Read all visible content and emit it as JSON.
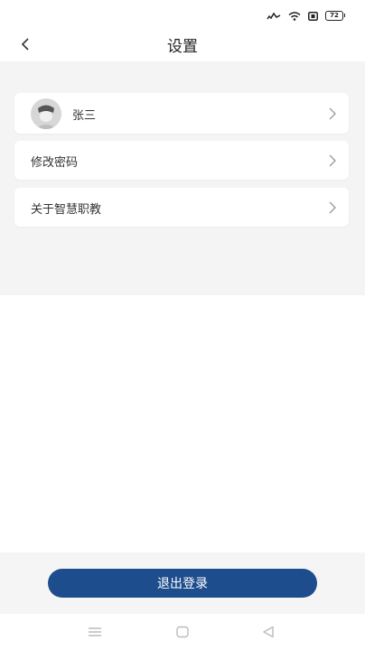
{
  "status_bar": {
    "battery_level": "72",
    "icons": [
      "signal-icon",
      "wifi-icon",
      "sim-icon",
      "battery-icon"
    ]
  },
  "nav": {
    "title": "设置",
    "back_icon": "chevron-left-icon"
  },
  "settings": {
    "profile_name": "张三",
    "items": [
      {
        "label": "修改密码"
      },
      {
        "label": "关于智慧职教"
      }
    ]
  },
  "actions": {
    "logout_label": "退出登录"
  },
  "colors": {
    "accent": "#1d4d8c",
    "page_bg": "#f4f4f4"
  },
  "system_nav": {
    "icons": [
      "menu-icon",
      "home-icon",
      "back-triangle-icon"
    ]
  }
}
